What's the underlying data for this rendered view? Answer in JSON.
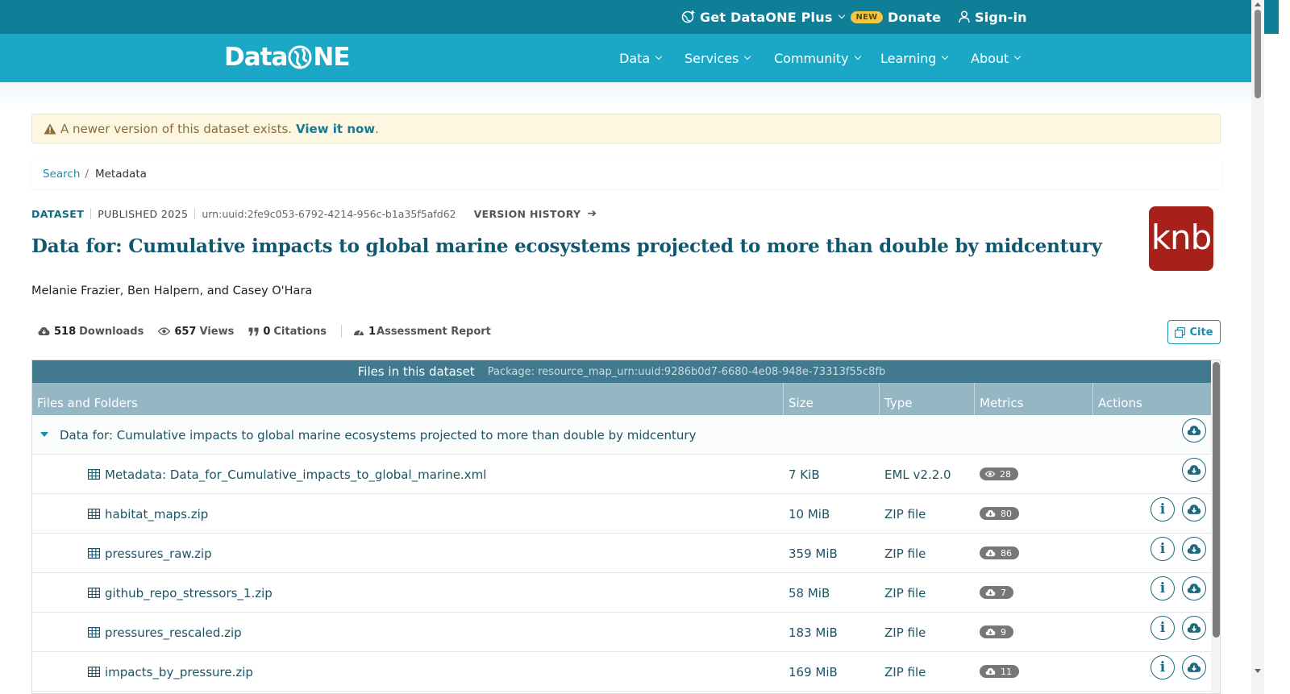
{
  "topbar": {
    "plus_label": "Get DataONE Plus",
    "plus_badge": "NEW",
    "donate_label": "Donate",
    "signin_label": "Sign-in"
  },
  "logo": {
    "left": "Data",
    "right": "NE"
  },
  "nav": [
    {
      "label": "Data"
    },
    {
      "label": "Services"
    },
    {
      "label": "Community"
    },
    {
      "label": "Learning"
    },
    {
      "label": "About"
    }
  ],
  "alert": {
    "text": "A newer version of this dataset exists.",
    "link": "View it now",
    "suffix": "."
  },
  "breadcrumb": {
    "search": "Search",
    "separator": "/",
    "current": "Metadata"
  },
  "dataset": {
    "tag": "DATASET",
    "published": "PUBLISHED 2025",
    "id": "urn:uuid:2fe9c053-6792-4214-956c-b1a35f5afd62",
    "version_history": "VERSION HISTORY",
    "title": "Data for: Cumulative impacts to global marine ecosystems projected to more than double by midcentury",
    "authors": "Melanie Frazier, Ben Halpern, and Casey O'Hara",
    "repo_logo": "knb"
  },
  "stats": {
    "downloads_count": "518",
    "downloads_label": "Downloads",
    "views_count": "657",
    "views_label": "Views",
    "citations_count": "0",
    "citations_label": "Citations",
    "assessment_count": "1",
    "assessment_label": "Assessment Report"
  },
  "cite_label": "Cite",
  "files": {
    "heading": "Files in this dataset",
    "package": "Package: resource_map_urn:uuid:9286b0d7-6680-4e08-948e-73313f55c8fb",
    "columns": {
      "files": "Files and Folders",
      "size": "Size",
      "type": "Type",
      "metrics": "Metrics",
      "actions": "Actions"
    },
    "folder": "Data for: Cumulative impacts to global marine ecosystems projected to more than double by midcentury",
    "rows": [
      {
        "name": "Metadata: Data_for_Cumulative_impacts_to_global_marine.xml",
        "size": "7 KiB",
        "type": "EML v2.2.0",
        "metric_icon": "eye-icon",
        "metric": "28",
        "info": false
      },
      {
        "name": "habitat_maps.zip",
        "size": "10 MiB",
        "type": "ZIP file",
        "metric_icon": "cloud-download-icon",
        "metric": "80",
        "info": true
      },
      {
        "name": "pressures_raw.zip",
        "size": "359 MiB",
        "type": "ZIP file",
        "metric_icon": "cloud-download-icon",
        "metric": "86",
        "info": true
      },
      {
        "name": "github_repo_stressors_1.zip",
        "size": "58 MiB",
        "type": "ZIP file",
        "metric_icon": "cloud-download-icon",
        "metric": "7",
        "info": true
      },
      {
        "name": "pressures_rescaled.zip",
        "size": "183 MiB",
        "type": "ZIP file",
        "metric_icon": "cloud-download-icon",
        "metric": "9",
        "info": true
      },
      {
        "name": "impacts_by_pressure.zip",
        "size": "169 MiB",
        "type": "ZIP file",
        "metric_icon": "cloud-download-icon",
        "metric": "11",
        "info": true
      }
    ]
  },
  "colors": {
    "topbar": "#0f7f98",
    "nav": "#1ba8c7",
    "title": "#10586f",
    "knb": "#a8201a",
    "table_header": "#41798f"
  }
}
